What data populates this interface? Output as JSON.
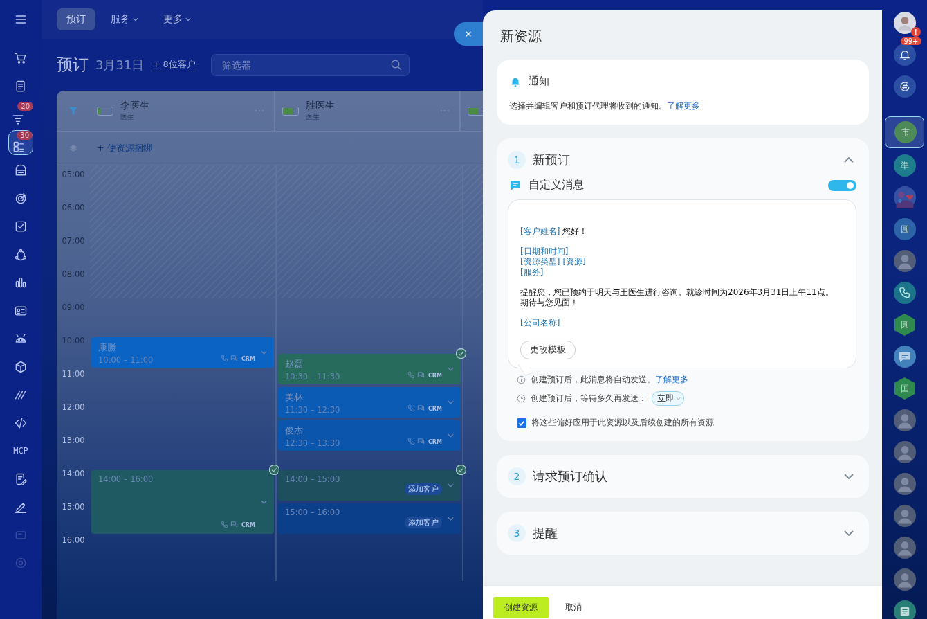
{
  "left_sidebar": {
    "items": [
      {
        "selected": false
      },
      {
        "selected": false
      },
      {
        "badge": "20",
        "selected": false
      },
      {
        "badge": "30",
        "selected": true
      },
      {
        "selected": false
      },
      {
        "selected": false
      },
      {
        "selected": false
      },
      {
        "selected": false
      },
      {
        "selected": false
      },
      {
        "selected": false
      },
      {
        "selected": false
      },
      {
        "selected": false
      },
      {
        "selected": false
      },
      {
        "selected": false
      },
      {
        "label": "MCP",
        "selected": false
      },
      {
        "selected": false
      },
      {
        "selected": false
      },
      {
        "selected": false
      },
      {
        "selected": false
      }
    ]
  },
  "nav": {
    "tabs": [
      {
        "label": "预订",
        "selected": true,
        "dropdown": false
      },
      {
        "label": "服务",
        "selected": false,
        "dropdown": true
      },
      {
        "label": "更多",
        "selected": false,
        "dropdown": true
      }
    ]
  },
  "heading": {
    "title": "预订",
    "date": "3月31日",
    "clients_link": "+ 8位客户",
    "filter": {
      "placeholder": "筛选器"
    }
  },
  "calendar": {
    "bundle_link": "+ 使资源捆绑",
    "hours": [
      "05:00",
      "06:00",
      "07:00",
      "08:00",
      "09:00",
      "10:00",
      "11:00",
      "12:00",
      "13:00",
      "14:00",
      "15:00",
      "16:00"
    ],
    "columns": [
      {
        "name": "李医生",
        "role": "医生",
        "level": 0.15,
        "events": [
          {
            "name": "康勝",
            "time": "10:00 – 11:00",
            "color": "#0b63c4",
            "confirmed": false,
            "crm": "CRM"
          },
          {
            "time": "14:00 – 16:00",
            "color": "#1f5a63",
            "confirmed": true,
            "crm": "CRM"
          }
        ]
      },
      {
        "name": "胜医生",
        "role": "医生",
        "level": 0.7,
        "events": [
          {
            "name": "赵磊",
            "time": "10:30 – 11:30",
            "color": "#276b5c",
            "confirmed": true,
            "crm": "CRM"
          },
          {
            "name": "美林",
            "time": "11:30 – 12:30",
            "color": "#0b5ab4",
            "confirmed": false,
            "crm": "CRM"
          },
          {
            "name": "俊杰",
            "time": "12:30 – 13:30",
            "color": "#0b55ac",
            "confirmed": false,
            "crm": "CRM"
          },
          {
            "time": "14:00 – 15:00",
            "color": "#1d4f5e",
            "confirmed": true,
            "tag": "添加客户"
          },
          {
            "time": "15:00 – 16:00",
            "color": "#0c3f8a",
            "confirmed": false,
            "tag": "添加客户"
          }
        ]
      },
      {
        "level": 0.7
      }
    ]
  },
  "panel": {
    "title": "新资源",
    "notice": {
      "title": "通知",
      "text": "选择并编辑客户和预订代理将收到的通知。",
      "link": "了解更多"
    },
    "sections": [
      {
        "number": "1",
        "title": "新预订",
        "expanded": true,
        "custom_message": {
          "label": "自定义消息",
          "on": true,
          "button": "更改模板",
          "lines": [
            {
              "kind": "line",
              "segments": [
                {
                  "kind": "token",
                  "text": "[客户姓名]"
                },
                {
                  "kind": "text",
                  "text": "您好！"
                }
              ]
            },
            {
              "kind": "gap"
            },
            {
              "kind": "line",
              "segments": [
                {
                  "kind": "token",
                  "text": "[日期和时间]"
                }
              ]
            },
            {
              "kind": "line",
              "segments": [
                {
                  "kind": "token",
                  "text": "[资源类型]"
                },
                {
                  "kind": "token",
                  "text": "[资源]"
                }
              ]
            },
            {
              "kind": "line",
              "segments": [
                {
                  "kind": "token",
                  "text": "[服务]"
                }
              ]
            },
            {
              "kind": "gap"
            },
            {
              "kind": "line",
              "segments": [
                {
                  "kind": "text",
                  "text": "提醒您，您已预约于明天与王医生进行咨询。就诊时间为2026年3月31日上午11点。期待与您见面！"
                }
              ]
            },
            {
              "kind": "gap"
            },
            {
              "kind": "line",
              "segments": [
                {
                  "kind": "token",
                  "text": "[公司名称]"
                }
              ]
            }
          ]
        },
        "hints": [
          {
            "kind": "info",
            "text": "创建预订后，此消息将自动发送。",
            "link": "了解更多"
          },
          {
            "kind": "delay",
            "text": "创建预订后，等待多久再发送：",
            "value": "立即"
          }
        ],
        "apply_all": {
          "label": "将这些偏好应用于此资源以及后续创建的所有资源",
          "checked": true
        }
      },
      {
        "number": "2",
        "title": "请求预订确认",
        "expanded": false
      },
      {
        "number": "3",
        "title": "提醒",
        "expanded": false
      }
    ],
    "footer": {
      "primary": "创建资源",
      "secondary": "取消"
    }
  },
  "right_sidebar": {
    "items": [
      {
        "kind": "avatar",
        "alert": "!",
        "selected": false
      },
      {
        "kind": "bell",
        "badge": "99+",
        "selected": false
      },
      {
        "kind": "chat",
        "selected": false
      },
      {
        "kind": "letter",
        "text": "市",
        "color": "#4e8a57",
        "selected": true
      },
      {
        "kind": "letter",
        "text": "準",
        "color": "#1d7d8c",
        "selected": false
      },
      {
        "kind": "picture",
        "selected": false
      },
      {
        "kind": "letter",
        "text": "圓",
        "color": "#2d64a8",
        "selected": false
      },
      {
        "kind": "person",
        "selected": false
      },
      {
        "kind": "phone",
        "color": "#1d7d8c",
        "selected": false
      },
      {
        "kind": "hexagon",
        "text": "圓",
        "color": "#2e8a4e",
        "selected": false
      },
      {
        "kind": "message",
        "color": "#4a8cc4",
        "selected": false
      },
      {
        "kind": "hexagon",
        "text": "国",
        "color": "#2e8a4e",
        "selected": false
      },
      {
        "kind": "person",
        "selected": false
      },
      {
        "kind": "person",
        "selected": false
      },
      {
        "kind": "person",
        "selected": false
      },
      {
        "kind": "person",
        "selected": false
      },
      {
        "kind": "person",
        "selected": false
      },
      {
        "kind": "person",
        "selected": false
      },
      {
        "kind": "news",
        "color": "#2e8a7a",
        "selected": false
      }
    ]
  }
}
